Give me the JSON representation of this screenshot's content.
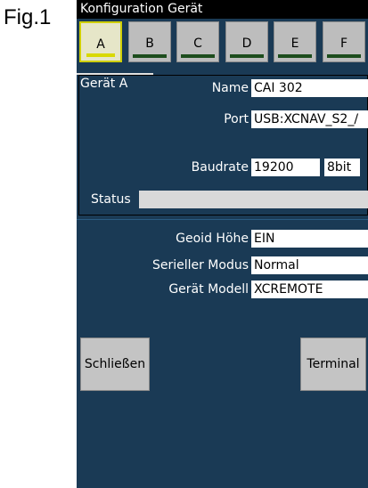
{
  "figure_label": "Fig.1",
  "window": {
    "title": "Konfiguration Gerät"
  },
  "tabs": [
    {
      "label": "A",
      "selected": true
    },
    {
      "label": "B",
      "selected": false
    },
    {
      "label": "C",
      "selected": false
    },
    {
      "label": "D",
      "selected": false
    },
    {
      "label": "E",
      "selected": false
    },
    {
      "label": "F",
      "selected": false
    }
  ],
  "device_panel": {
    "heading": "Gerät A",
    "name_label": "Name",
    "name_value": "CAI 302",
    "port_label": "Port",
    "port_value": "USB:XCNAV_S2_/",
    "baudrate_label": "Baudrate",
    "baudrate_value": "19200",
    "bits_value": "8bit",
    "status_label": "Status",
    "status_value": ""
  },
  "settings": {
    "geoid_label": "Geoid Höhe",
    "geoid_value": "EIN",
    "serial_mode_label": "Serieller Modus",
    "serial_mode_value": "Normal",
    "model_label": "Gerät Modell",
    "model_value": "XCREMOTE"
  },
  "buttons": {
    "close": "Schließen",
    "terminal": "Terminal"
  },
  "colors": {
    "background": "#1a3a55",
    "titlebar": "#000000",
    "tab_selected_indicator": "#d9d900",
    "tab_indicator": "#1d4d1d",
    "button": "#c4c4c4"
  }
}
